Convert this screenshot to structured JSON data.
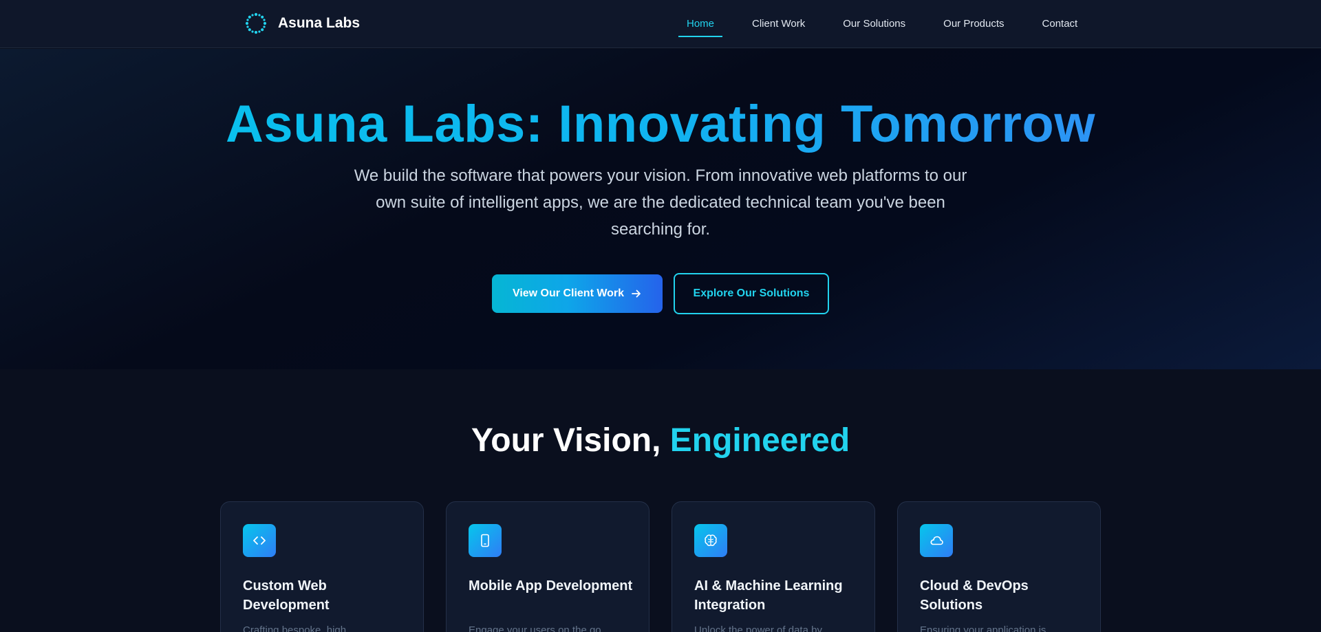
{
  "brand": {
    "name": "Asuna Labs",
    "logo_icon": "dotted-ring-logo-icon",
    "accent": "#22d3ee"
  },
  "nav": {
    "links": [
      {
        "label": "Home",
        "active": true
      },
      {
        "label": "Client Work",
        "active": false
      },
      {
        "label": "Our Solutions",
        "active": false
      },
      {
        "label": "Our Products",
        "active": false
      },
      {
        "label": "Contact",
        "active": false
      }
    ]
  },
  "hero": {
    "title": "Asuna Labs: Innovating Tomorrow",
    "subtitle": "We build the software that powers your vision. From innovative web platforms to our own suite of intelligent apps, we are the dedicated technical team you've been searching for.",
    "primary_button": "View Our Client Work",
    "primary_button_icon": "arrow-right-icon",
    "secondary_button": "Explore Our Solutions"
  },
  "services": {
    "title_main": "Your Vision, ",
    "title_accent": "Engineered",
    "cards": [
      {
        "icon": "code-icon",
        "title": "Custom Web Development",
        "desc": "Crafting bespoke, high"
      },
      {
        "icon": "smartphone-icon",
        "title": "Mobile App Development",
        "desc": "Engage your users on the go"
      },
      {
        "icon": "brain-icon",
        "title": "AI & Machine Learning Integration",
        "desc": "Unlock the power of data by"
      },
      {
        "icon": "cloud-icon",
        "title": "Cloud & DevOps Solutions",
        "desc": "Ensuring your application is"
      }
    ]
  }
}
